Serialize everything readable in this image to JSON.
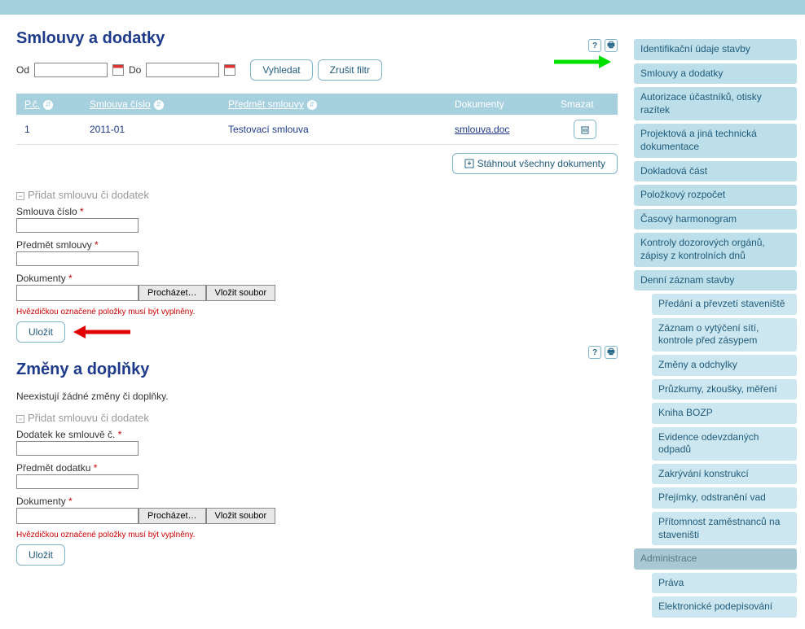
{
  "section1": {
    "title": "Smlouvy a dodatky",
    "filter": {
      "od": "Od",
      "do": "Do",
      "search": "Vyhledat",
      "clear": "Zrušit filtr"
    },
    "table": {
      "headers": {
        "pc": "P.č.",
        "cislo": "Smlouva číslo",
        "predmet": "Předmět smlouvy",
        "dok": "Dokumenty",
        "del": "Smazat"
      },
      "rows": [
        {
          "pc": "1",
          "cislo": "2011-01",
          "predmet": "Testovací smlouva",
          "doc": "smlouva.doc"
        }
      ]
    },
    "download_all": "Stáhnout všechny dokumenty",
    "toggle": "Přidat smlouvu či dodatek",
    "form": {
      "cislo": "Smlouva číslo",
      "predmet": "Předmět smlouvy",
      "dokumenty": "Dokumenty",
      "browse": "Procházet…",
      "upload": "Vložit soubor"
    },
    "note": "Hvězdičkou označené položky musí být vyplněny.",
    "save": "Uložit"
  },
  "section2": {
    "title": "Změny a doplňky",
    "none": "Neexistují žádné změny či doplňky.",
    "toggle": "Přidat smlouvu či dodatek",
    "form": {
      "dodatek": "Dodatek ke smlouvě č.",
      "predmet": "Předmět dodatku",
      "dokumenty": "Dokumenty",
      "browse": "Procházet…",
      "upload": "Vložit soubor"
    },
    "note": "Hvězdičkou označené položky musí být vyplněny.",
    "save": "Uložit"
  },
  "sidebar": {
    "items": [
      {
        "label": "Identifikační údaje stavby",
        "type": "item"
      },
      {
        "label": "Smlouvy a dodatky",
        "type": "item",
        "active": true
      },
      {
        "label": "Autorizace účastníků, otisky razítek",
        "type": "item"
      },
      {
        "label": "Projektová a jiná technická dokumentace",
        "type": "item"
      },
      {
        "label": "Dokladová část",
        "type": "item"
      },
      {
        "label": "Položkový rozpočet",
        "type": "item"
      },
      {
        "label": "Časový harmonogram",
        "type": "item"
      },
      {
        "label": "Kontroly dozorových orgánů, zápisy z kontrolních dnů",
        "type": "item"
      },
      {
        "label": "Denní záznam stavby",
        "type": "item"
      },
      {
        "label": "Předání a převzetí staveniště",
        "type": "sub"
      },
      {
        "label": "Záznam o vytýčení sítí, kontrole před zásypem",
        "type": "sub"
      },
      {
        "label": "Změny a odchylky",
        "type": "sub"
      },
      {
        "label": "Průzkumy, zkoušky, měření",
        "type": "sub"
      },
      {
        "label": "Kniha BOZP",
        "type": "sub"
      },
      {
        "label": "Evidence odevzdaných odpadů",
        "type": "sub"
      },
      {
        "label": "Zakrývání konstrukcí",
        "type": "sub"
      },
      {
        "label": "Přejímky, odstranění vad",
        "type": "sub"
      },
      {
        "label": "Přítomnost zaměstnanců na staveništi",
        "type": "sub"
      },
      {
        "label": "Administrace",
        "type": "header"
      },
      {
        "label": "Práva",
        "type": "sub"
      },
      {
        "label": "Elektronické podepisování",
        "type": "sub"
      }
    ]
  },
  "icons": {
    "help": "?",
    "print": "⎙",
    "trash": "🗑"
  }
}
